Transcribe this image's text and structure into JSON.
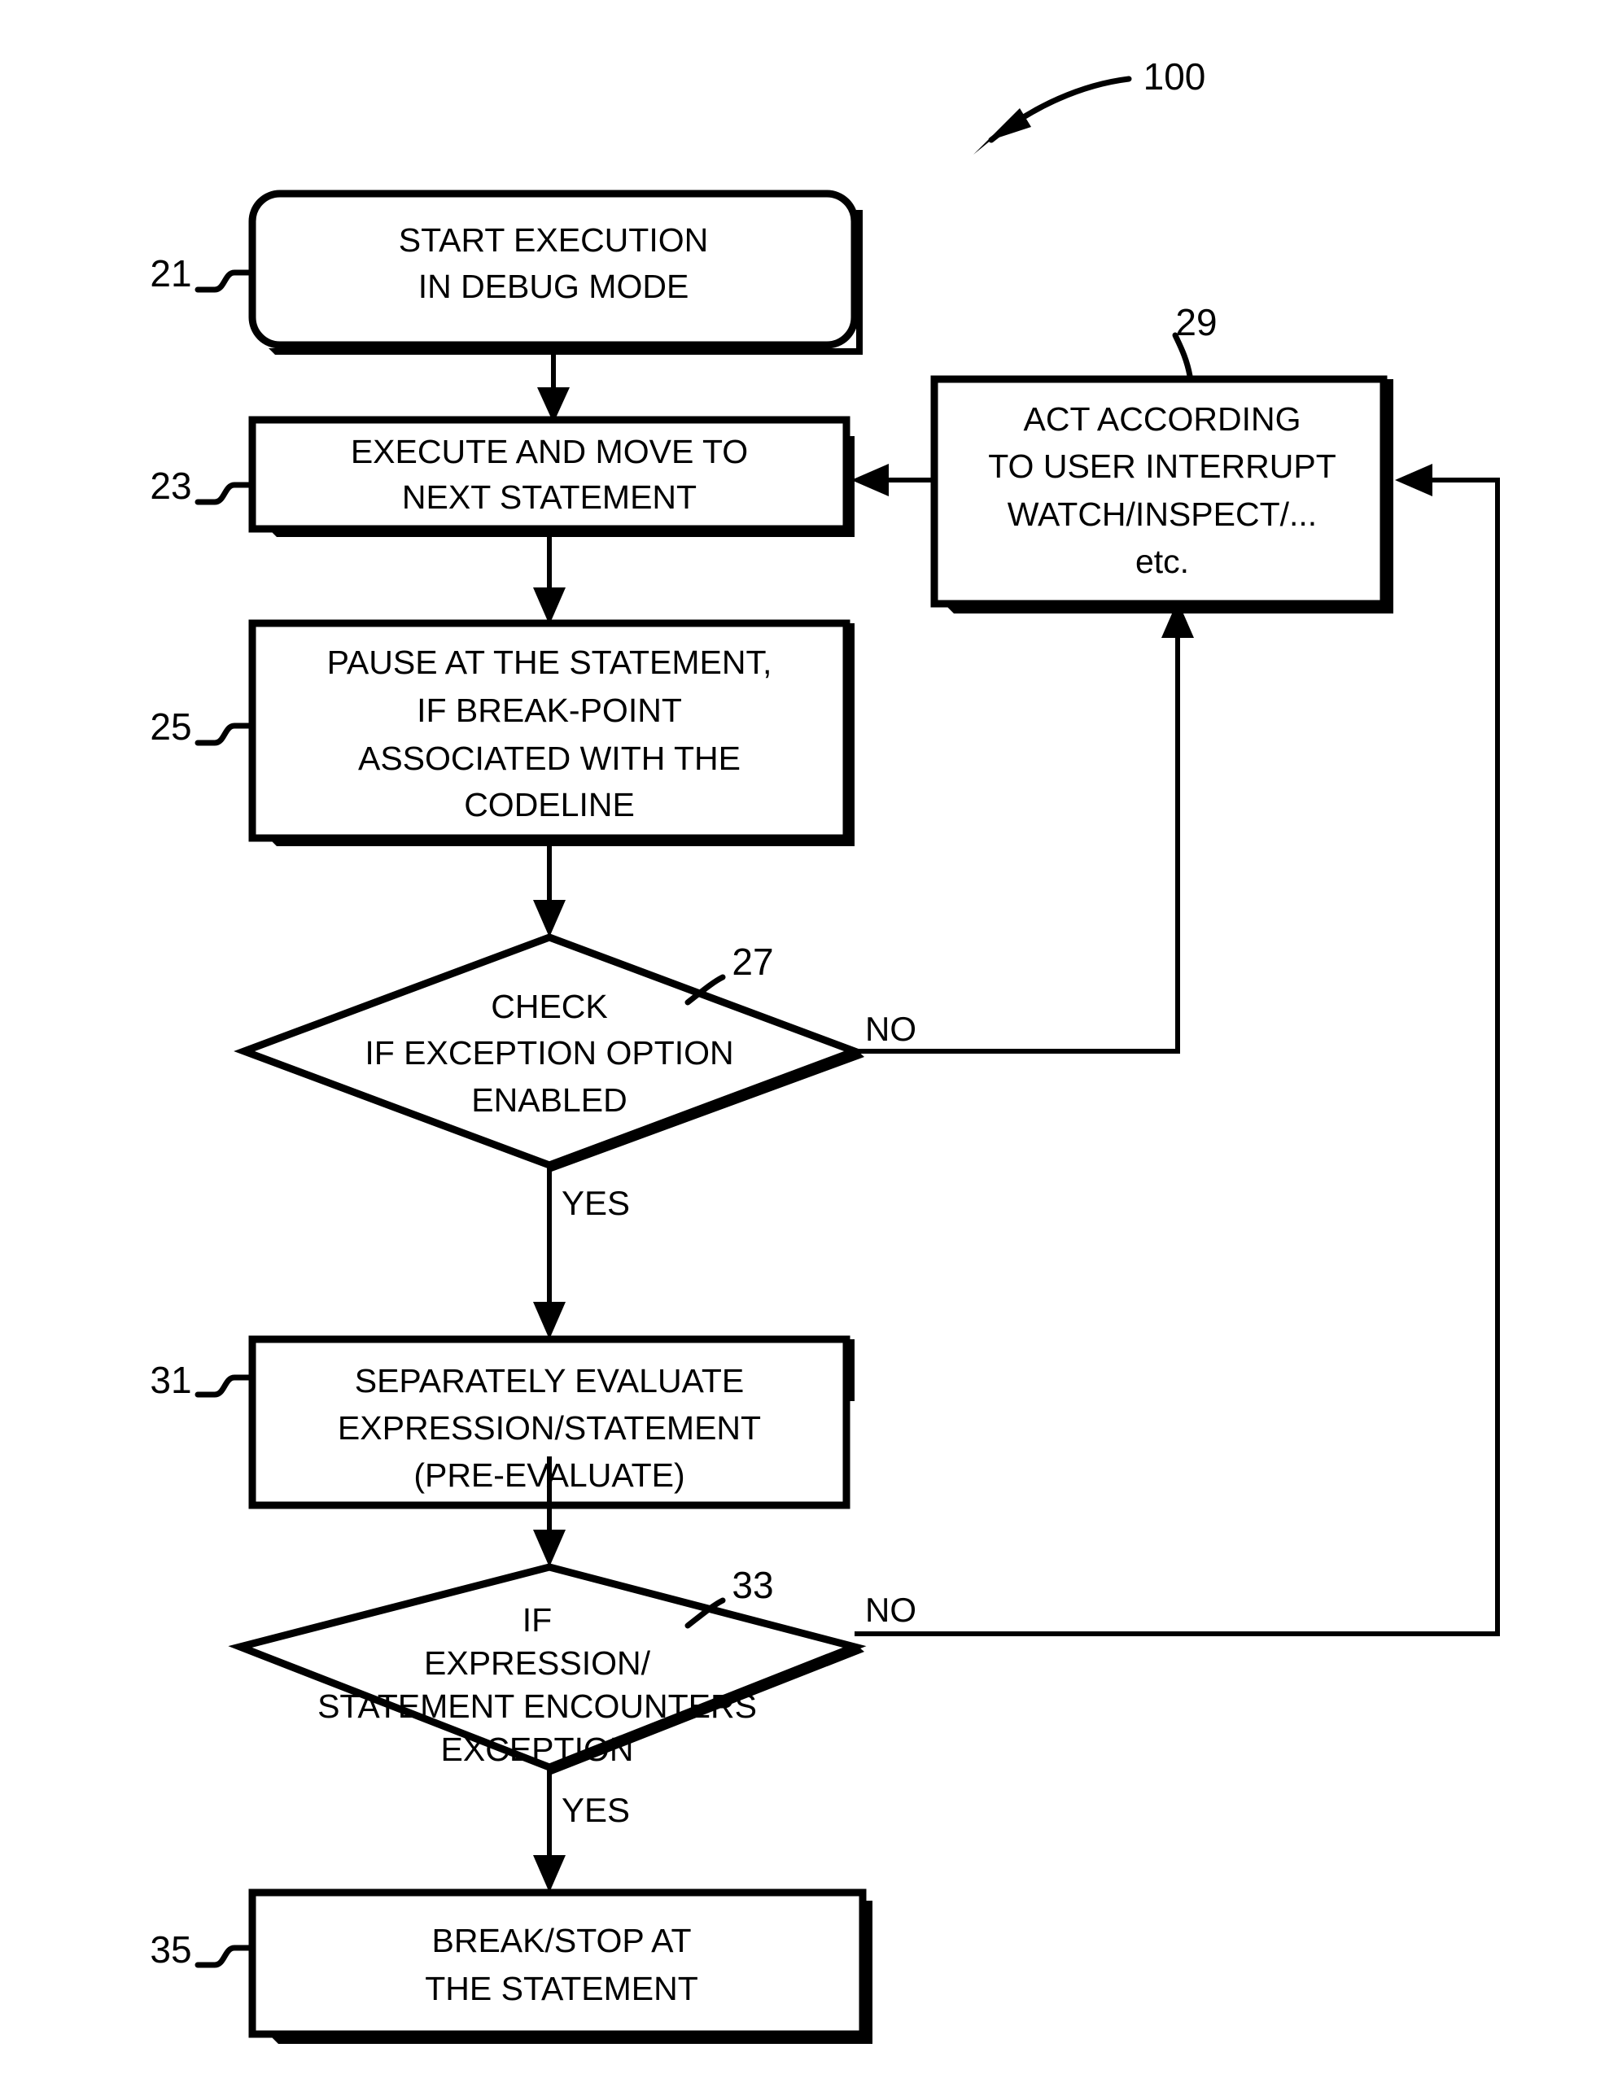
{
  "figure": {
    "number": "100",
    "number_name": "figure-reference-100"
  },
  "nodes": [
    {
      "ref": "21",
      "shape": "rounded-rectangle",
      "name": "node-start-execution",
      "lines": [
        "START EXECUTION",
        "IN DEBUG MODE"
      ]
    },
    {
      "ref": "23",
      "shape": "rectangle",
      "name": "node-execute-and-move",
      "lines": [
        "EXECUTE AND MOVE TO",
        "NEXT STATEMENT"
      ]
    },
    {
      "ref": "25",
      "shape": "rectangle",
      "name": "node-pause-at-statement",
      "lines": [
        "PAUSE AT THE STATEMENT,",
        "IF BREAK-POINT",
        "ASSOCIATED WITH THE",
        "CODELINE"
      ]
    },
    {
      "ref": "27",
      "shape": "diamond",
      "name": "node-check-exception-option",
      "lines": [
        "CHECK",
        "IF EXCEPTION OPTION",
        "ENABLED"
      ]
    },
    {
      "ref": "29",
      "shape": "rectangle",
      "name": "node-act-according-to-user-interrupt",
      "lines": [
        "ACT ACCORDING",
        "TO USER INTERRUPT",
        "WATCH/INSPECT/...",
        "etc."
      ]
    },
    {
      "ref": "31",
      "shape": "rectangle",
      "name": "node-separately-evaluate",
      "lines": [
        "SEPARATELY EVALUATE",
        "EXPRESSION/STATEMENT",
        "(PRE-EVALUATE)"
      ]
    },
    {
      "ref": "33",
      "shape": "diamond",
      "name": "node-if-expression-encounters-exception",
      "lines": [
        "IF",
        "EXPRESSION/",
        "STATEMENT ENCOUNTERS",
        "EXCEPTION"
      ]
    },
    {
      "ref": "35",
      "shape": "rectangle",
      "name": "node-break-stop-at-statement",
      "lines": [
        "BREAK/STOP AT",
        "THE STATEMENT"
      ]
    }
  ],
  "edge_labels": {
    "check_no": "NO",
    "check_yes": "YES",
    "exception_no": "NO",
    "exception_yes": "YES"
  },
  "colors": {
    "stroke": "#000000",
    "fill": "#ffffff",
    "background": "#ffffff"
  }
}
